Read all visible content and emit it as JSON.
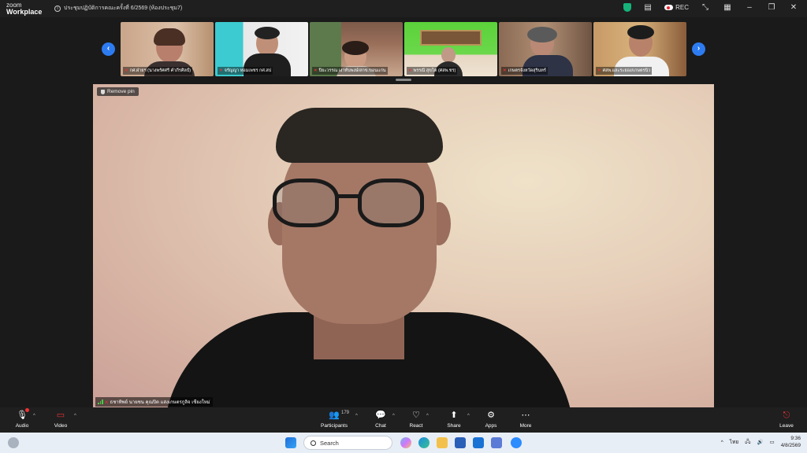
{
  "titlebar": {
    "logo_line1": "zoom",
    "logo_line2": "Workplace",
    "meeting_title": "ประชุมปฏิบัติการคณะครั้งที่ 6/2569 (ห้องประชุม7)",
    "rec_label": "REC"
  },
  "participants_strip": {
    "tiles": [
      {
        "name": "กศ.ฝ่ายฯ (นางพรัศศรี คำภีรศิลป์)"
      },
      {
        "name": "จรัญญา หอมเพชร กศ.สป"
      },
      {
        "name": "ปิยะวรรณ เงาทับพงษ์/สกข.ขอนแก่น"
      },
      {
        "name": "พรรณี สุขโต (ศสพ.ชร)"
      },
      {
        "name": "เกษตรจังหวัดสุรินทร์"
      },
      {
        "name": "ศสพ.และระยอง/เกษตรนิว"
      }
    ]
  },
  "main_video": {
    "remove_pin_label": "Remove pin",
    "speaker_name": "ธชาทิพย์ นายชน คุณปิต แสงเกษตรกูลิจ เชียงใหม่"
  },
  "toolbar": {
    "audio": "Audio",
    "video": "Video",
    "participants": "Participants",
    "participants_count": "179",
    "chat": "Chat",
    "react": "React",
    "share": "Share",
    "apps": "Apps",
    "more": "More",
    "leave": "Leave"
  },
  "taskbar": {
    "search_placeholder": "Search",
    "lang": "ไทย",
    "time": "9:36",
    "date": "4/8/2569"
  }
}
